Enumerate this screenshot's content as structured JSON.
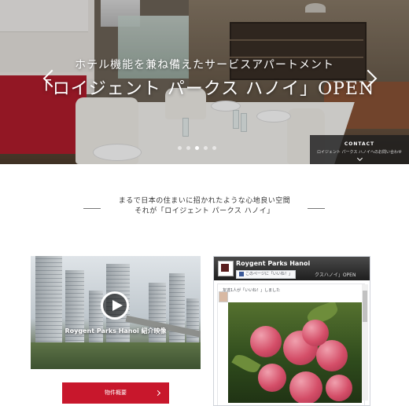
{
  "hero": {
    "subtitle": "ホテル機能を兼ね備えたサービスアパートメント",
    "title": "「ロイジェント パークス ハノイ」OPEN",
    "slides_total": 5,
    "slides_active": 3
  },
  "contact": {
    "title": "CONTACT",
    "subtitle": "ロイジェント パークス ハノイへのお問い合わせ"
  },
  "intro": {
    "line1": "まるで日本の住まいに招かれたような心地良い空間",
    "line2": "それが「ロイジェント パークス ハノイ」"
  },
  "video": {
    "caption": "Roygent Parks Hanoi 紹介映像",
    "play_icon": "play-icon"
  },
  "button": {
    "label": "物件概要"
  },
  "facebook": {
    "page_name": "Roygent Parks Hanoi",
    "like_label": "このページに「いいね！」",
    "header_tail": "クスハノイ」OPEN",
    "post_text": "友達1人が「いいね！」しました"
  },
  "colors": {
    "accent": "#c8172c",
    "dark": "#1e1e1e"
  }
}
